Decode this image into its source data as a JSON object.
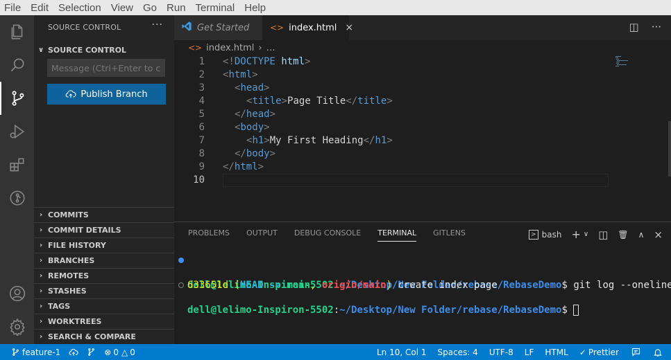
{
  "menubar": [
    "File",
    "Edit",
    "Selection",
    "View",
    "Go",
    "Run",
    "Terminal",
    "Help"
  ],
  "sidebar": {
    "title": "SOURCE CONTROL",
    "more": "···",
    "section": "SOURCE CONTROL",
    "message_placeholder": "Message (Ctrl+Enter to c...",
    "publish_label": "Publish Branch",
    "panels": [
      "COMMITS",
      "COMMIT DETAILS",
      "FILE HISTORY",
      "BRANCHES",
      "REMOTES",
      "STASHES",
      "TAGS",
      "WORKTREES",
      "SEARCH & COMPARE"
    ]
  },
  "tabs": {
    "get_started": "Get Started",
    "active": "index.html",
    "close": "×"
  },
  "breadcrumb": {
    "file": "index.html",
    "rest": "…"
  },
  "editor": {
    "line_numbers": [
      "1",
      "2",
      "3",
      "4",
      "5",
      "6",
      "7",
      "8",
      "9",
      "10"
    ],
    "line1": [
      "<!",
      "DOCTYPE",
      " ",
      "html",
      ">"
    ],
    "line2": [
      "<",
      "html",
      ">"
    ],
    "line3": [
      "<",
      "head",
      ">"
    ],
    "line4": [
      "<",
      "title",
      ">",
      "Page Title",
      "</",
      "title",
      ">"
    ],
    "line5": [
      "</",
      "head",
      ">"
    ],
    "line6": [
      "<",
      "body",
      ">"
    ],
    "line7": [
      "<",
      "h1",
      ">",
      "My First Heading",
      "</",
      "h1",
      ">"
    ],
    "line8": [
      "</",
      "body",
      ">"
    ],
    "line9": [
      "</",
      "html",
      ">"
    ]
  },
  "panel": {
    "tabs": [
      "PROBLEMS",
      "OUTPUT",
      "DEBUG CONSOLE",
      "TERMINAL",
      "GITLENS"
    ],
    "active_tab": "TERMINAL",
    "shell": "bash",
    "terminal": {
      "user": "dell@lelimo-Inspiron-5502",
      "colon": ":",
      "path": "~/Desktop/New Folder/rebase/RebaseDemo",
      "prompt": "$ ",
      "command": "git log --oneline",
      "hash": "633651d",
      "open_paren": " (",
      "head": "HEAD -> ",
      "main": "main",
      "comma": ", ",
      "origin": "origin/main",
      "close_paren": ")",
      "message": " create index page"
    }
  },
  "status": {
    "branch": "feature-1",
    "errors": "0",
    "warnings": "0",
    "position": "Ln 10, Col 1",
    "spaces": "Spaces: 4",
    "encoding": "UTF-8",
    "eol": "LF",
    "language": "HTML",
    "prettier": "Prettier"
  },
  "colors": {
    "status_bar": "#007acc",
    "publish_button": "#0e639c",
    "activity_bar": "#333333",
    "sidebar": "#252526",
    "editor": "#1e1e1e"
  },
  "icons": [
    "explorer-icon",
    "search-icon",
    "source-control-icon",
    "run-debug-icon",
    "extensions-icon",
    "gitlens-icon",
    "account-icon",
    "settings-gear-icon"
  ]
}
